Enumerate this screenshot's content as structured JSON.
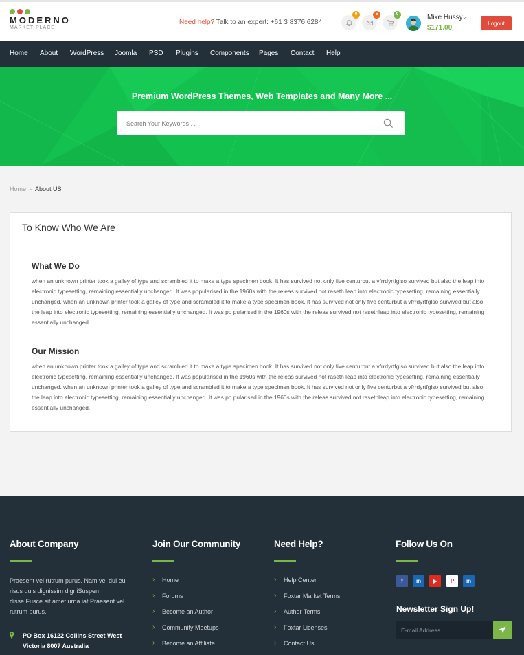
{
  "brand": {
    "name": "MODERNO",
    "tagline": "MARKET PLACE",
    "dot_colors": [
      "#7ab648",
      "#e14b3b",
      "#7ab648"
    ]
  },
  "header": {
    "help_prefix": "Need help?",
    "help_text": " Talk to an expert: +61 3 8376 6284",
    "notifications": {
      "icon": "bell-icon",
      "count": "0"
    },
    "messages": {
      "icon": "envelope-icon",
      "count": "5"
    },
    "cart": {
      "icon": "cart-icon",
      "count": "0"
    },
    "user_name": "Mike Hussy",
    "balance": "$171.00",
    "logout_label": "Logout"
  },
  "nav": {
    "items": [
      "Home",
      "About",
      "WordPress",
      "Joomla",
      "PSD",
      "Plugins",
      "Components",
      "Pages",
      "Contact",
      "Help"
    ]
  },
  "hero": {
    "title": "Premium WordPress Themes, Web Templates and Many More ...",
    "search_placeholder": "Search Your Keywords . . ."
  },
  "breadcrumb": {
    "home": "Home",
    "separator": "-",
    "current": "About US"
  },
  "about": {
    "heading": "To Know Who We Are",
    "sections": [
      {
        "title": "What We Do",
        "body": "when an unknown printer took a galley of type and scrambled it to make a type specimen book. It has survived not only five centurbut a vfrrdyrtfglso survived but also the leap into electronic typesetting, remaining essentially unchanged. It was popularised in the 1960s with the releas survived not raseth leap into electronic typesetting, remaining essentially unchanged. when an unknown printer took a galley of type and scrambled it to make a type specimen book. It has survived not only five centurbut a vfrrdyrtfglso survived but also the leap into electronic typesetting, remaining essentially unchanged. It was po pularised in the 1960s with the releas survived not rasethleap into electronic typesetting, remaining essentially unchanged."
      },
      {
        "title": "Our Mission",
        "body": "when an unknown printer took a galley of type and scrambled it to make a type specimen book. It has survived not only five centurbut a vfrrdyrtfglso survived but also the leap into electronic typesetting, remaining essentially unchanged. It was popularised in the 1960s with the releas survived not raseth leap into electronic typesetting, remaining essentially unchanged. when an unknown printer took a galley of type and scrambled it to make a type specimen book. It has survived not only five centurbut a vfrrdyrtfglso survived but also the leap into electronic typesetting, remaining essentially unchanged. It was po pularised in the 1960s with the releas survived not rasethleap into electronic typesetting, remaining essentially unchanged."
      }
    ]
  },
  "footer": {
    "about": {
      "title": "About Company",
      "text": "Praesent vel rutrum purus. Nam vel dui eu risus duis dignissim digniSuspen disse.Fusce sit amet urna iat.Praesent vel rutrum purus.",
      "address": "PO Box 16122 Collins Street West Victoria 8007 Australia"
    },
    "community": {
      "title": "Join Our Community",
      "links": [
        "Home",
        "Forums",
        "Become an Author",
        "Community Meetups",
        "Become an Affiliate"
      ]
    },
    "help": {
      "title": "Need Help?",
      "links": [
        "Help Center",
        "Foxtar Market Terms",
        "Author Terms",
        "Foxtar Licenses",
        "Contact Us"
      ]
    },
    "follow": {
      "title": "Follow Us On",
      "social": [
        {
          "name": "facebook-icon",
          "glyph": "f",
          "color": "#3b5998"
        },
        {
          "name": "linkedin-icon",
          "glyph": "in",
          "color": "#1a66b0"
        },
        {
          "name": "youtube-icon",
          "glyph": "▶",
          "color": "#e02a20"
        },
        {
          "name": "pinterest-icon",
          "glyph": "P",
          "color": "#cb2027"
        },
        {
          "name": "linkedin-icon",
          "glyph": "in",
          "color": "#1a66b0"
        }
      ]
    },
    "newsletter": {
      "title": "Newsletter Sign Up!",
      "placeholder": "E-mail Address"
    }
  },
  "colors": {
    "accent": "#7ab648",
    "danger": "#e14b3b",
    "nav_bg": "#243039",
    "hero_bg": "#13c14f"
  }
}
